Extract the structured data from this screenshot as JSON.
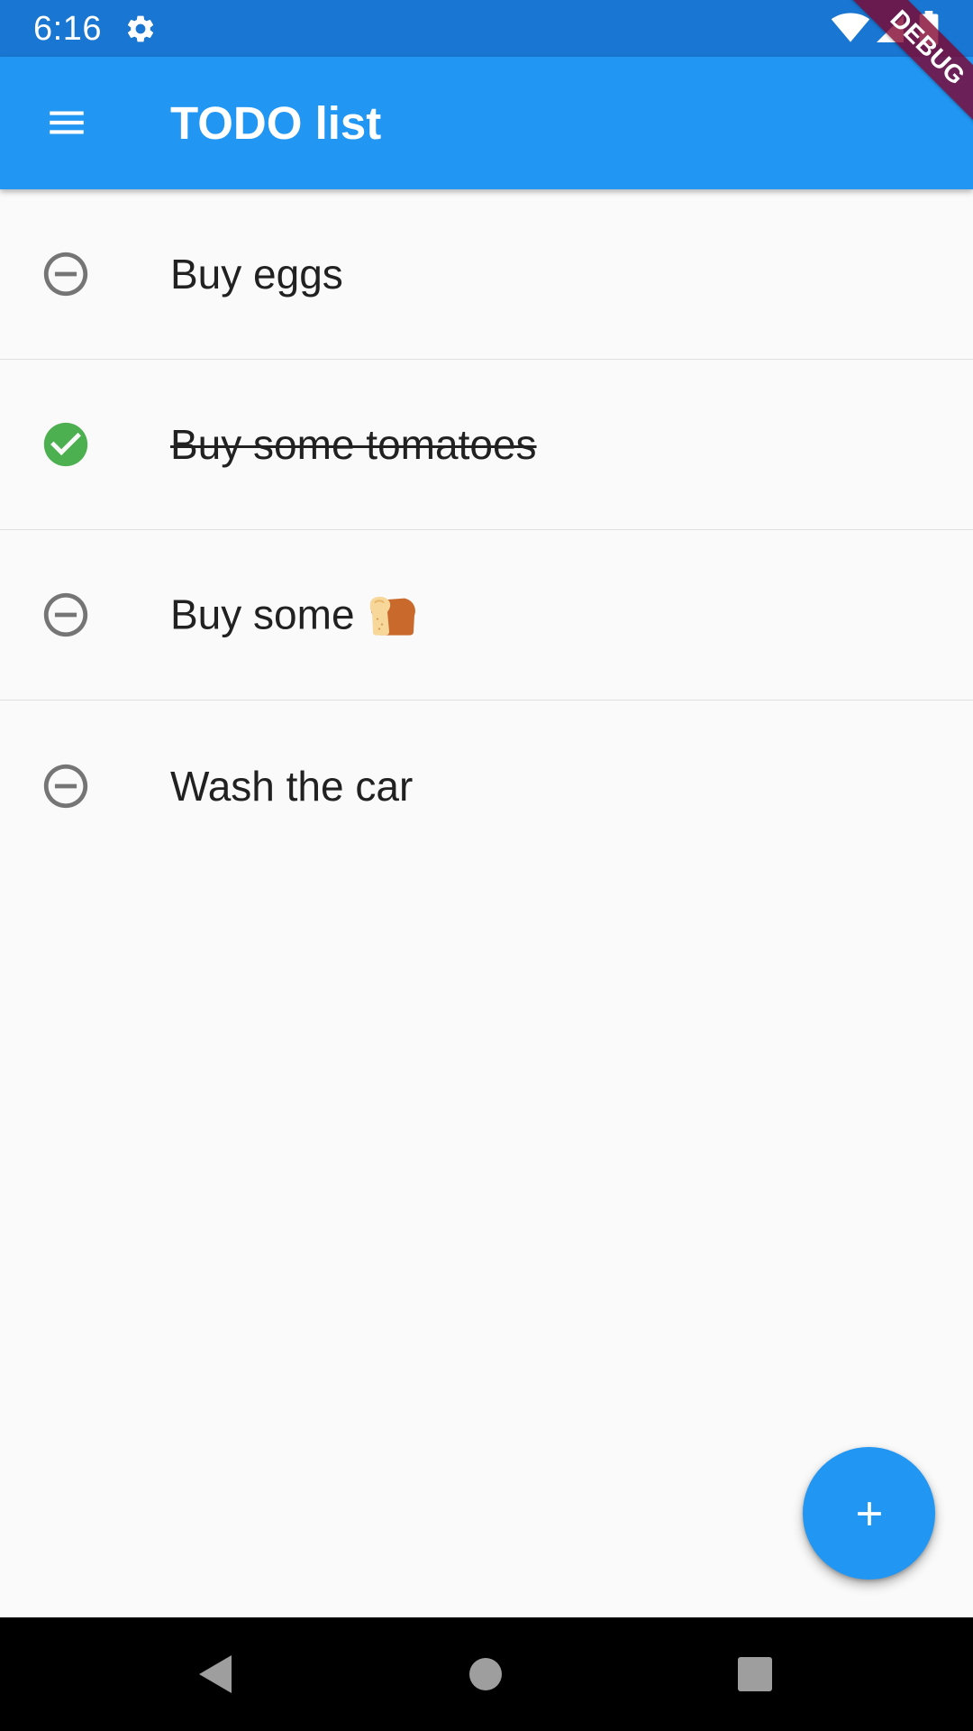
{
  "status_bar": {
    "time": "6:16",
    "icons": [
      "gear-icon",
      "wifi-icon",
      "signal-icon",
      "battery-icon"
    ],
    "color": "#1976d2"
  },
  "app_bar": {
    "title": "TODO list",
    "menu_icon": "menu-icon",
    "color": "#2196f3"
  },
  "debug_banner": {
    "label": "DEBUG"
  },
  "todos": [
    {
      "text": "Buy eggs",
      "done": false,
      "status_icon": "remove-circle-outline-icon"
    },
    {
      "text": "Buy some tomatoes",
      "done": true,
      "status_icon": "check-circle-icon"
    },
    {
      "text": "Buy some",
      "emoji": "bread-icon",
      "done": false,
      "status_icon": "remove-circle-outline-icon"
    },
    {
      "text": "Wash the car",
      "done": false,
      "status_icon": "remove-circle-outline-icon"
    }
  ],
  "fab": {
    "icon": "add-icon"
  },
  "nav_bar": {
    "buttons": [
      "back-icon",
      "home-icon",
      "recents-icon"
    ]
  },
  "colors": {
    "done": "#4caf50",
    "pending": "#757575",
    "text": "#212121",
    "background": "#fafafa"
  }
}
